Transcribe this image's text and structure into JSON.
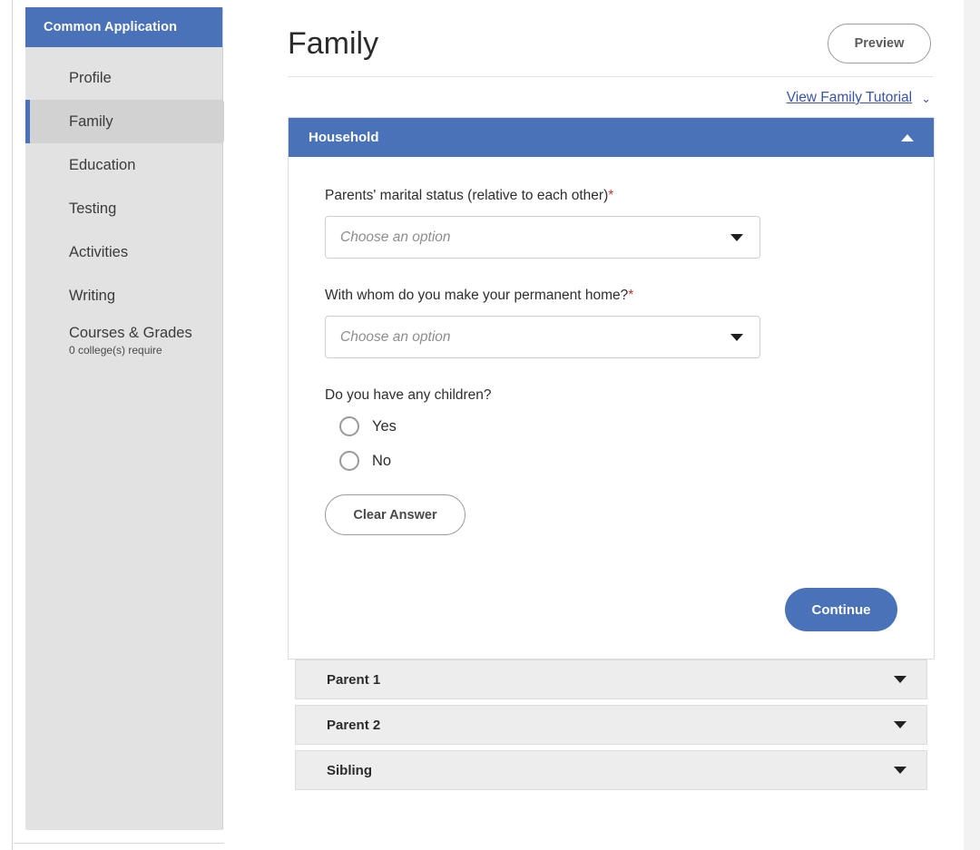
{
  "sidebar": {
    "header_title": "Common Application",
    "items": [
      {
        "label": "Profile",
        "sub": "",
        "active": false
      },
      {
        "label": "Family",
        "sub": "",
        "active": true
      },
      {
        "label": "Education",
        "sub": "",
        "active": false
      },
      {
        "label": "Testing",
        "sub": "",
        "active": false
      },
      {
        "label": "Activities",
        "sub": "",
        "active": false
      },
      {
        "label": "Writing",
        "sub": "",
        "active": false
      },
      {
        "label": "Courses & Grades",
        "sub": "0 college(s) require",
        "active": false
      }
    ]
  },
  "header": {
    "title": "Family",
    "preview_label": "Preview"
  },
  "tutorial": {
    "link_label": "View Family Tutorial",
    "chevron": "⌄"
  },
  "household": {
    "title": "Household",
    "fields": [
      {
        "label": "Parents' marital status (relative to each other)",
        "required": "*",
        "placeholder": "Choose an option"
      },
      {
        "label": "With whom do you make your permanent home?",
        "required": "*",
        "placeholder": "Choose an option"
      }
    ],
    "children_question": "Do you have any children?",
    "radio_yes": "Yes",
    "radio_no": "No",
    "clear_label": "Clear Answer",
    "continue_label": "Continue"
  },
  "collapsed_sections": [
    {
      "title": "Parent 1"
    },
    {
      "title": "Parent 2"
    },
    {
      "title": "Sibling"
    }
  ],
  "colors": {
    "brand_blue": "#4a72b8",
    "link_blue": "#3a53a4",
    "required_red": "#c0392b",
    "sidebar_bg": "#e2e2e2",
    "sidebar_active": "#d2d2d2",
    "collapsed_bg": "#ededed"
  }
}
